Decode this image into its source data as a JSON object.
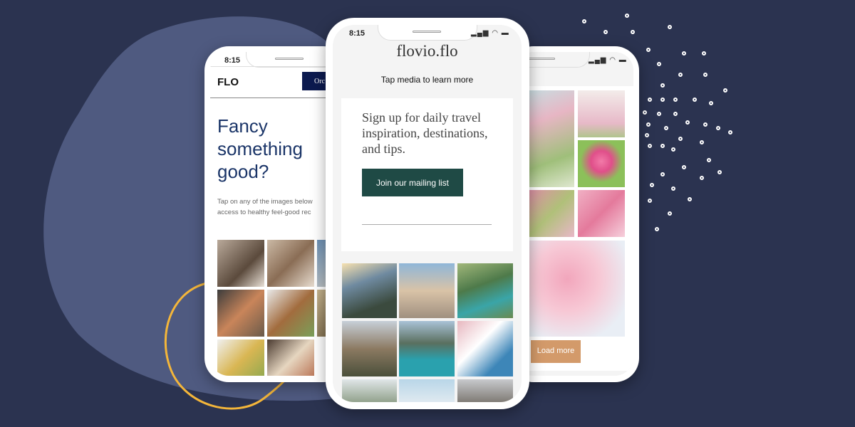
{
  "colors": {
    "background": "#2b3350",
    "blob": "#4f5a80",
    "accent_curve": "#f4b63a",
    "left_nav_button": "#0c1a4f",
    "headline": "#1b3568",
    "mailing_button": "#1f4a45",
    "load_more": "#d39a6a"
  },
  "left_phone": {
    "time": "8:15",
    "logo": "FLO",
    "nav_button": "Orc",
    "headline": "Fancy something good?",
    "body": "Tap on any of the images below access to healthy feel-good rec"
  },
  "center_phone": {
    "time": "8:15",
    "status_icons": [
      "signal-icon",
      "wifi-icon",
      "battery-icon"
    ],
    "brand": "flovio.flo",
    "subtitle": "Tap media to learn more",
    "signup_heading": "Sign up for daily travel inspiration, destinations, and tips.",
    "signup_button": "Join our mailing list"
  },
  "right_phone": {
    "status_icons": [
      "signal-icon",
      "wifi-icon",
      "battery-icon"
    ],
    "load_more": "Load more"
  }
}
